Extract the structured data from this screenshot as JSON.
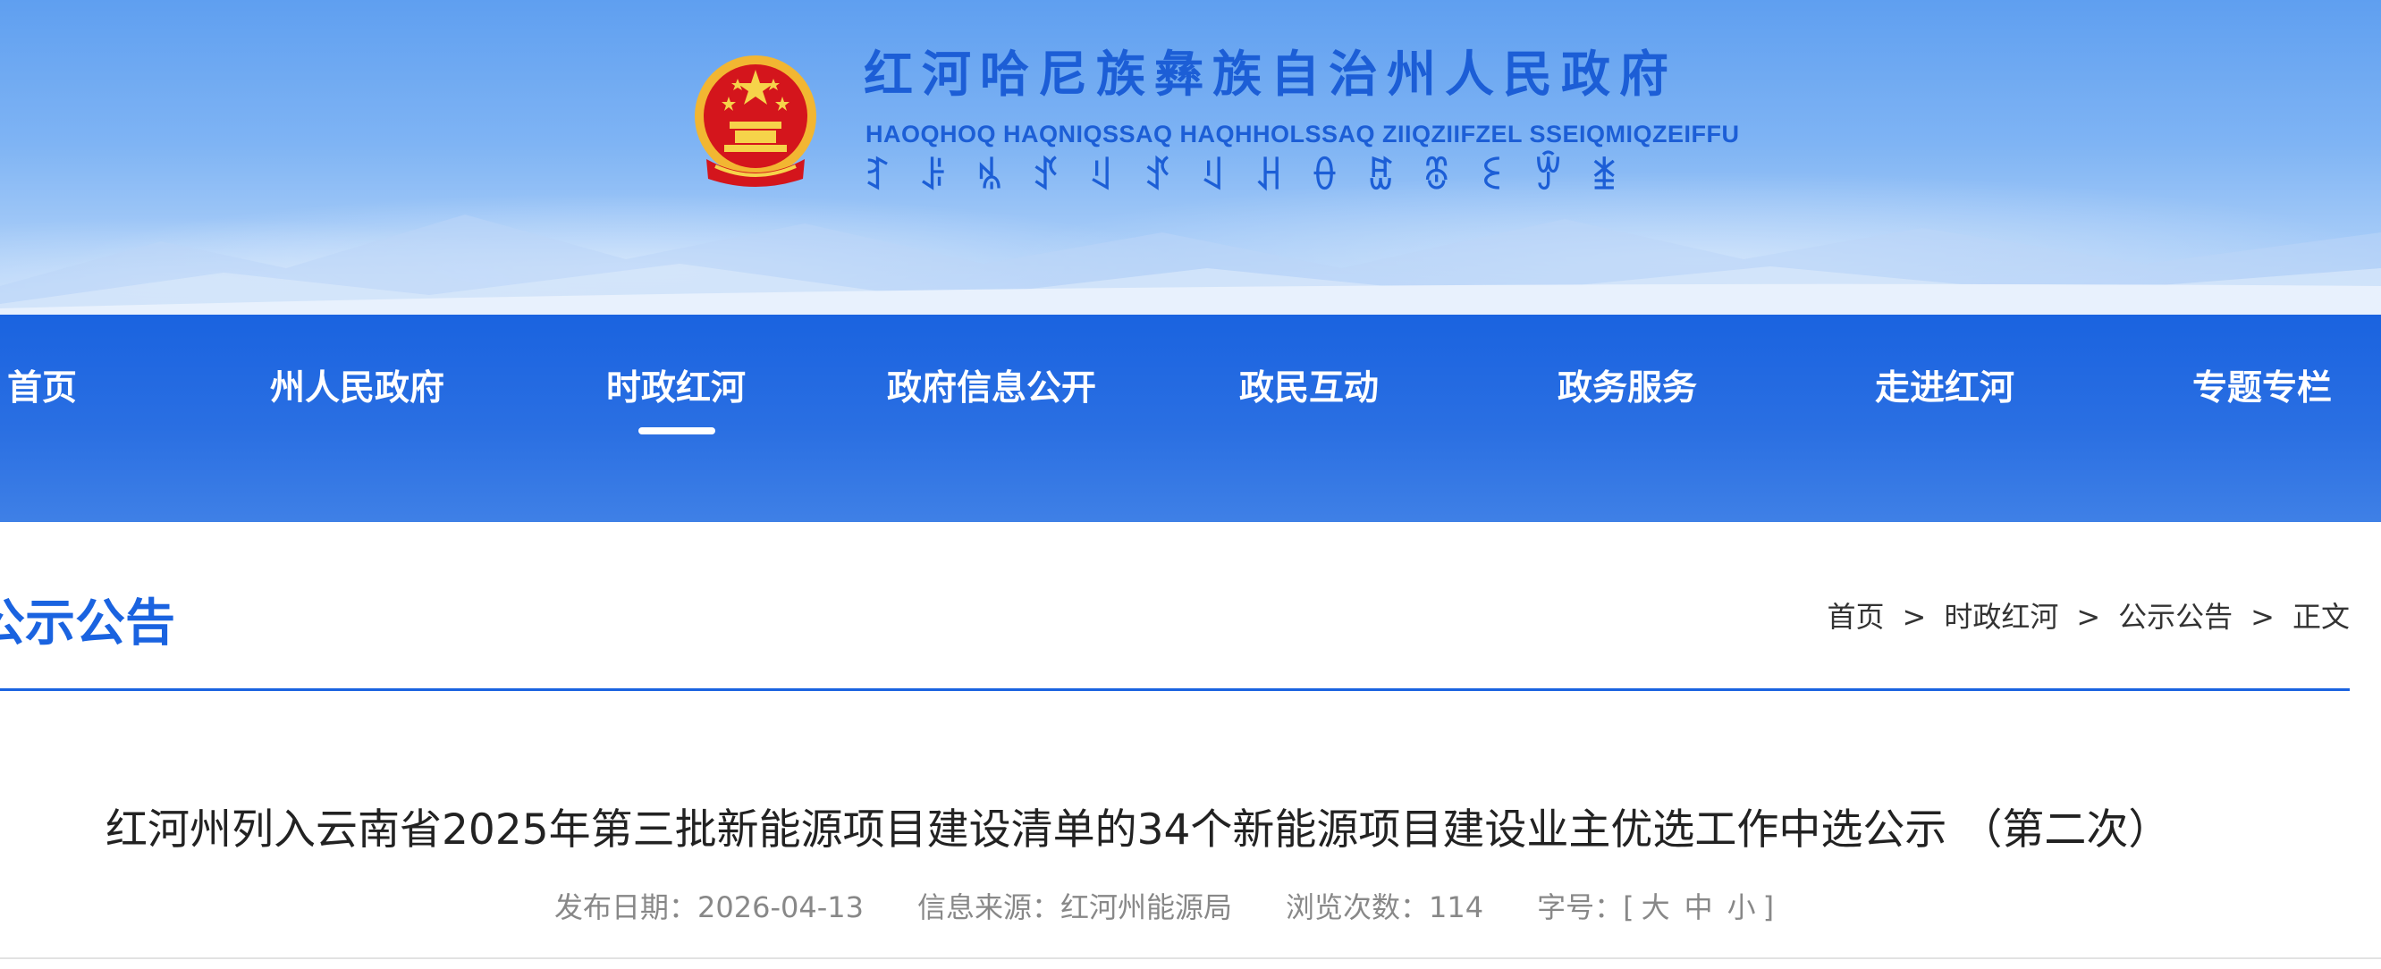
{
  "header": {
    "site_title": "红河哈尼族彝族自治州人民政府",
    "site_subtitle": "HAOQHOQ HAQNIQSSAQ HAQHHOLSSAQ ZIIQZIIFZEL SSEIQMIQZEIFFU",
    "yi_script_glyphs": [
      "ꆈ",
      "ꌠ",
      "ꁱ",
      "ꀋ",
      "ꆹ",
      "ꀋ",
      "ꆹ",
      "ꃅ",
      "ꂷ",
      "ꐺ",
      "ꁨ",
      "ꏂ",
      "ꏭ",
      "ꁧ"
    ],
    "emblem_icon": "national-emblem-icon"
  },
  "nav": {
    "items": [
      {
        "label": "首页"
      },
      {
        "label": "州人民政府"
      },
      {
        "label": "时政红河",
        "active": true
      },
      {
        "label": "政府信息公开"
      },
      {
        "label": "政民互动"
      },
      {
        "label": "政务服务"
      },
      {
        "label": "走进红河"
      },
      {
        "label": "专题专栏"
      }
    ]
  },
  "section": {
    "title": "公示公告",
    "breadcrumb": [
      "首页",
      "时政红河",
      "公示公告",
      "正文"
    ],
    "breadcrumb_separator": ">"
  },
  "article": {
    "title": "红河州列入云南省2025年第三批新能源项目建设清单的34个新能源项目建设业主优选工作中选公示 （第二次）",
    "publish_label": "发布日期：",
    "publish_date": "2026-04-13",
    "source_label": "信息来源：",
    "source": "红河州能源局",
    "views_label": "浏览次数：",
    "views": "114",
    "font_size_label": "字号：",
    "font_size_open": "[",
    "font_size_large": "大",
    "font_size_medium": "中",
    "font_size_small": "小",
    "font_size_close": "]"
  },
  "colors": {
    "brand_blue": "#1a63e0",
    "title_blue": "#1c5ed6",
    "nav_text": "#ffffff",
    "meta_gray": "#888888"
  }
}
